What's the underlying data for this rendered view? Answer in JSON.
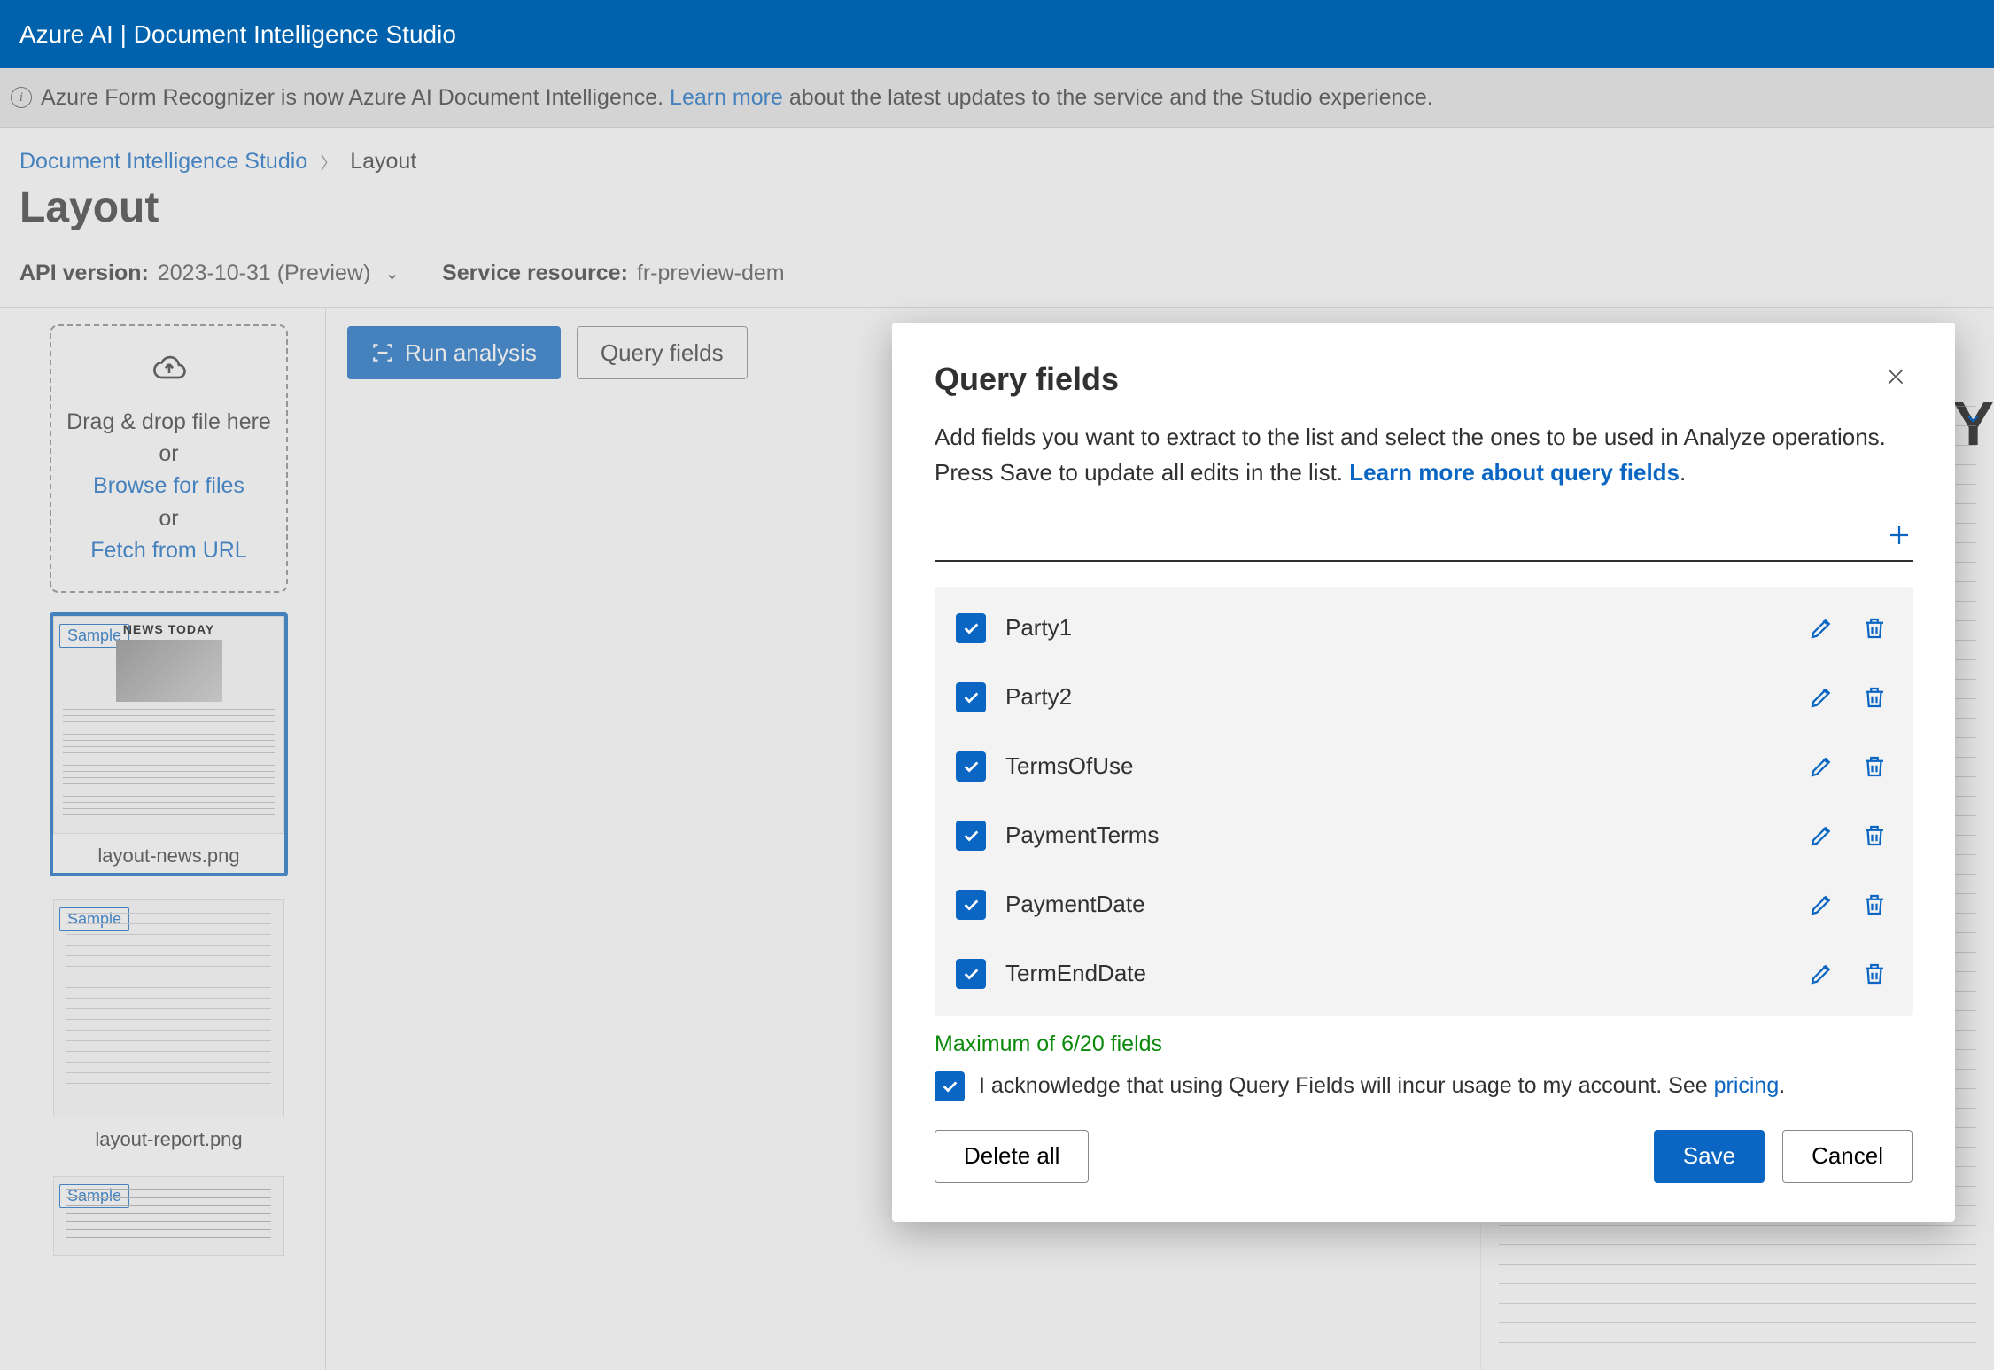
{
  "banner": {
    "title": "Azure AI | Document Intelligence Studio"
  },
  "infobar": {
    "prefix": "Azure Form Recognizer is now Azure AI Document Intelligence. ",
    "link": "Learn more",
    "suffix": " about the latest updates to the service and the Studio experience."
  },
  "breadcrumb": {
    "root": "Document Intelligence Studio",
    "current": "Layout"
  },
  "page": {
    "title": "Layout"
  },
  "meta": {
    "api_label": "API version:",
    "api_value": "2023-10-31 (Preview)",
    "resource_label": "Service resource:",
    "resource_value": "fr-preview-dem"
  },
  "dropzone": {
    "line1": "Drag & drop file here or",
    "browse": "Browse for files",
    "or": "or",
    "fetch": "Fetch from URL"
  },
  "thumbs": [
    {
      "tag": "Sample",
      "filename": "layout-news.png",
      "headline": "NEWS TODAY",
      "selected": true
    },
    {
      "tag": "Sample",
      "filename": "layout-report.png",
      "selected": false
    },
    {
      "tag": "Sample",
      "filename": "",
      "selected": false
    }
  ],
  "toolbar": {
    "run": "Run analysis",
    "query": "Query fields"
  },
  "doc": {
    "big_letter": "Y"
  },
  "modal": {
    "title": "Query fields",
    "desc_prefix": "Add fields you want to extract to the list and select the ones to be used in Analyze operations. Press Save to update all edits in the list. ",
    "desc_link": "Learn more about query fields",
    "fields": [
      {
        "name": "Party1",
        "checked": true
      },
      {
        "name": "Party2",
        "checked": true
      },
      {
        "name": "TermsOfUse",
        "checked": true
      },
      {
        "name": "PaymentTerms",
        "checked": true
      },
      {
        "name": "PaymentDate",
        "checked": true
      },
      {
        "name": "TermEndDate",
        "checked": true
      }
    ],
    "limit": "Maximum of 6/20 fields",
    "ack_text": "I acknowledge that using Query Fields will incur usage to my account. See ",
    "ack_link": "pricing",
    "delete_all": "Delete all",
    "save": "Save",
    "cancel": "Cancel"
  }
}
